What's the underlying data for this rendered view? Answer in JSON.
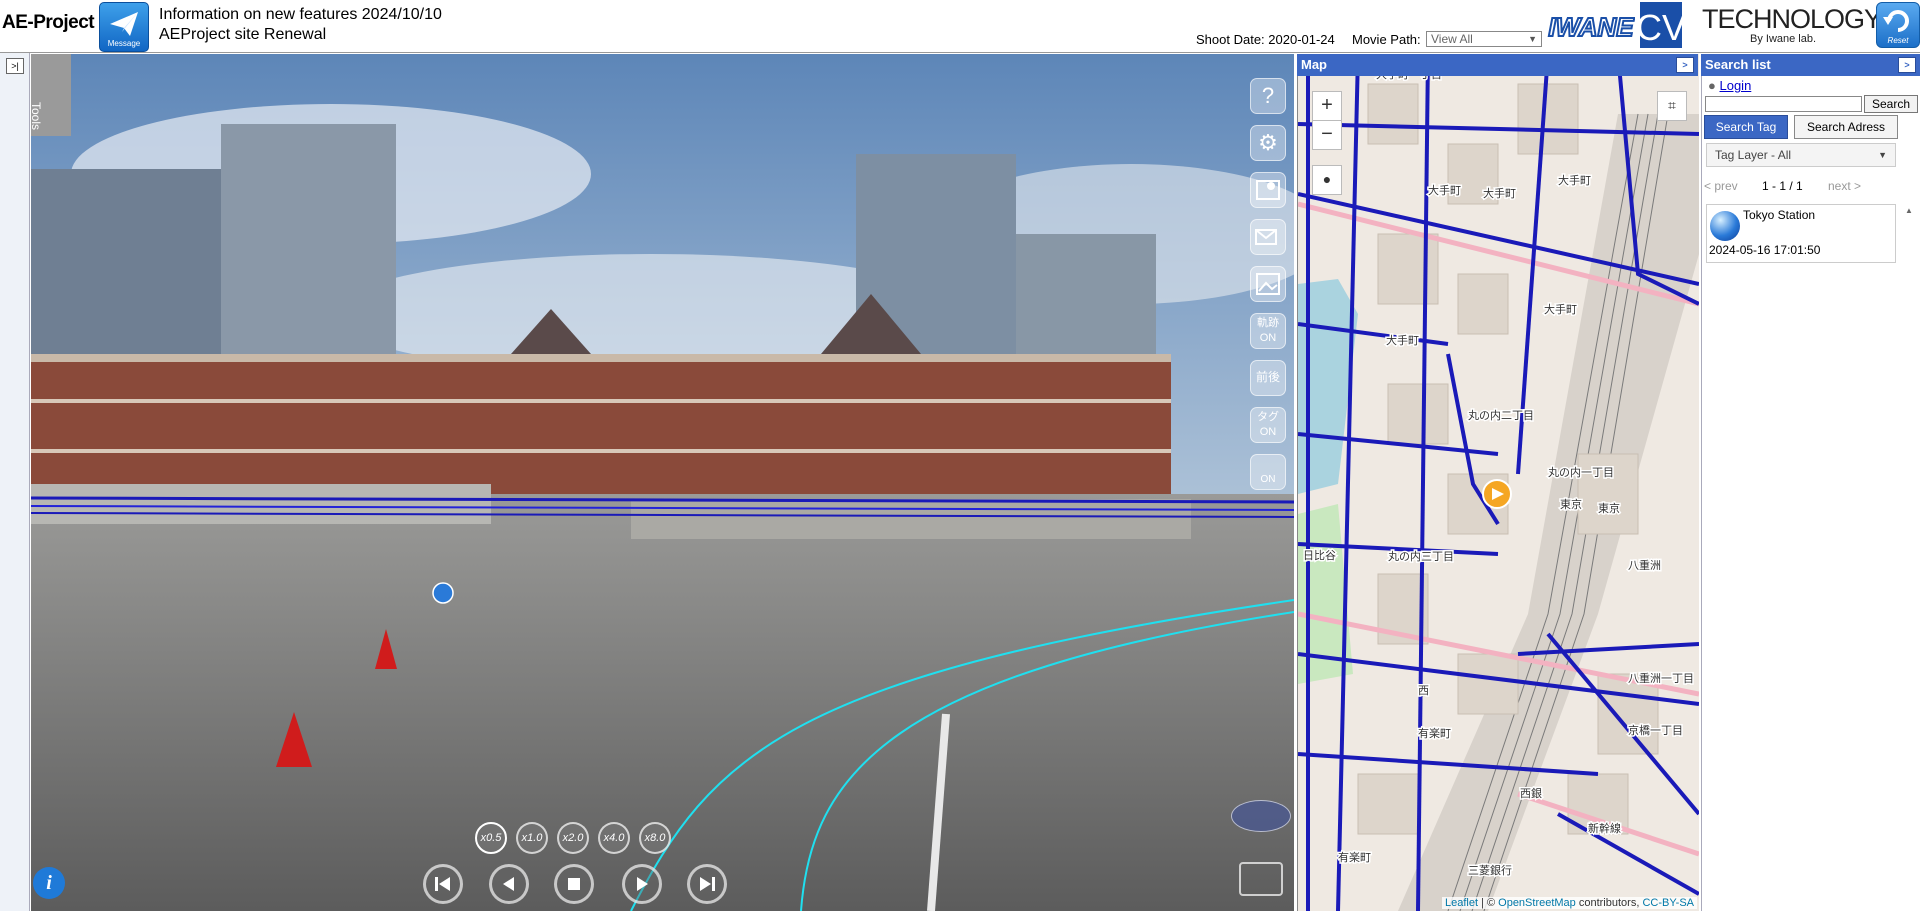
{
  "header": {
    "logo": "AE-Project",
    "message_label": "Message",
    "news_line1": "Information on new features 2024/10/10",
    "news_line2": "AEProject site Renewal",
    "shoot_date": "Shoot Date: 2020-01-24",
    "movie_path_label": "Movie Path:",
    "movie_path_value": "View All",
    "iwane_logo": "IWANE",
    "cv_logo": "CV",
    "tech_logo": "TECHNOLOGY",
    "tech_tm": "TM",
    "tech_by": "By Iwane lab.",
    "reset_label": "Reset"
  },
  "left": {
    "expand_icon": "expand-icon"
  },
  "viewer": {
    "tools_label": "Tools",
    "tool_buttons": [
      {
        "name": "help-icon",
        "label": "?"
      },
      {
        "name": "settings-gear-icon",
        "label": "⚙"
      },
      {
        "name": "map-pin-icon",
        "label": ""
      },
      {
        "name": "mail-icon",
        "label": ""
      },
      {
        "name": "photo-icon",
        "label": ""
      },
      {
        "name": "trajectory-toggle",
        "label": "軌跡 ON"
      },
      {
        "name": "front-back-button",
        "label": "前後"
      },
      {
        "name": "tag-toggle",
        "label": "タグ ON"
      },
      {
        "name": "camera-toggle",
        "label": "ON"
      }
    ],
    "speeds": [
      "x0.5",
      "x1.0",
      "x2.0",
      "x4.0",
      "x8.0"
    ],
    "playback": [
      "step-back-icon",
      "play-back-icon",
      "stop-icon",
      "play-forward-icon",
      "step-forward-icon"
    ],
    "info_icon": "i"
  },
  "map": {
    "title": "Map",
    "zoom_in": "+",
    "zoom_out": "−",
    "labels": [
      "大手町一丁目",
      "大手町",
      "大手町",
      "大手町",
      "大手町",
      "大手町",
      "丸の内二丁目",
      "丸の内一丁目",
      "丸の内三丁目",
      "有楽町",
      "有楽町",
      "東京",
      "東京",
      "八重洲",
      "八重洲一丁目",
      "京橋一丁目",
      "西",
      "日比谷",
      "三菱銀行",
      "西銀",
      "新幹線"
    ],
    "attribution_leaflet": "Leaflet",
    "attribution_sep": " | © ",
    "attribution_osm": "OpenStreetMap",
    "attribution_contrib": " contributors, ",
    "attribution_license": "CC-BY-SA"
  },
  "search": {
    "title": "Search list",
    "login": "Login",
    "search_button": "Search",
    "search_tag": "Search Tag",
    "search_address": "Search Adress",
    "tag_layer": "Tag Layer - All",
    "prev": "< prev",
    "page": "1 - 1 / 1",
    "next": "next >",
    "results": [
      {
        "name": "Tokyo Station",
        "date": "2024-05-16 17:01:50"
      }
    ]
  },
  "colors": {
    "accent": "#3b67c4",
    "route_blue": "#1a1ab8",
    "track_cyan": "#1fe0f0"
  }
}
